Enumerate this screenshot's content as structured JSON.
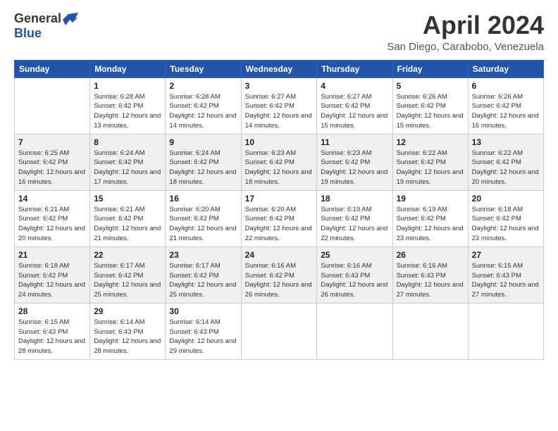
{
  "logo": {
    "general": "General",
    "blue": "Blue"
  },
  "title": "April 2024",
  "subtitle": "San Diego, Carabobo, Venezuela",
  "days_of_week": [
    "Sunday",
    "Monday",
    "Tuesday",
    "Wednesday",
    "Thursday",
    "Friday",
    "Saturday"
  ],
  "weeks": [
    [
      {
        "num": "",
        "sunrise": "",
        "sunset": "",
        "daylight": ""
      },
      {
        "num": "1",
        "sunrise": "Sunrise: 6:28 AM",
        "sunset": "Sunset: 6:42 PM",
        "daylight": "Daylight: 12 hours and 13 minutes."
      },
      {
        "num": "2",
        "sunrise": "Sunrise: 6:28 AM",
        "sunset": "Sunset: 6:42 PM",
        "daylight": "Daylight: 12 hours and 14 minutes."
      },
      {
        "num": "3",
        "sunrise": "Sunrise: 6:27 AM",
        "sunset": "Sunset: 6:42 PM",
        "daylight": "Daylight: 12 hours and 14 minutes."
      },
      {
        "num": "4",
        "sunrise": "Sunrise: 6:27 AM",
        "sunset": "Sunset: 6:42 PM",
        "daylight": "Daylight: 12 hours and 15 minutes."
      },
      {
        "num": "5",
        "sunrise": "Sunrise: 6:26 AM",
        "sunset": "Sunset: 6:42 PM",
        "daylight": "Daylight: 12 hours and 15 minutes."
      },
      {
        "num": "6",
        "sunrise": "Sunrise: 6:26 AM",
        "sunset": "Sunset: 6:42 PM",
        "daylight": "Daylight: 12 hours and 16 minutes."
      }
    ],
    [
      {
        "num": "7",
        "sunrise": "Sunrise: 6:25 AM",
        "sunset": "Sunset: 6:42 PM",
        "daylight": "Daylight: 12 hours and 16 minutes."
      },
      {
        "num": "8",
        "sunrise": "Sunrise: 6:24 AM",
        "sunset": "Sunset: 6:42 PM",
        "daylight": "Daylight: 12 hours and 17 minutes."
      },
      {
        "num": "9",
        "sunrise": "Sunrise: 6:24 AM",
        "sunset": "Sunset: 6:42 PM",
        "daylight": "Daylight: 12 hours and 18 minutes."
      },
      {
        "num": "10",
        "sunrise": "Sunrise: 6:23 AM",
        "sunset": "Sunset: 6:42 PM",
        "daylight": "Daylight: 12 hours and 18 minutes."
      },
      {
        "num": "11",
        "sunrise": "Sunrise: 6:23 AM",
        "sunset": "Sunset: 6:42 PM",
        "daylight": "Daylight: 12 hours and 19 minutes."
      },
      {
        "num": "12",
        "sunrise": "Sunrise: 6:22 AM",
        "sunset": "Sunset: 6:42 PM",
        "daylight": "Daylight: 12 hours and 19 minutes."
      },
      {
        "num": "13",
        "sunrise": "Sunrise: 6:22 AM",
        "sunset": "Sunset: 6:42 PM",
        "daylight": "Daylight: 12 hours and 20 minutes."
      }
    ],
    [
      {
        "num": "14",
        "sunrise": "Sunrise: 6:21 AM",
        "sunset": "Sunset: 6:42 PM",
        "daylight": "Daylight: 12 hours and 20 minutes."
      },
      {
        "num": "15",
        "sunrise": "Sunrise: 6:21 AM",
        "sunset": "Sunset: 6:42 PM",
        "daylight": "Daylight: 12 hours and 21 minutes."
      },
      {
        "num": "16",
        "sunrise": "Sunrise: 6:20 AM",
        "sunset": "Sunset: 6:42 PM",
        "daylight": "Daylight: 12 hours and 21 minutes."
      },
      {
        "num": "17",
        "sunrise": "Sunrise: 6:20 AM",
        "sunset": "Sunset: 6:42 PM",
        "daylight": "Daylight: 12 hours and 22 minutes."
      },
      {
        "num": "18",
        "sunrise": "Sunrise: 6:19 AM",
        "sunset": "Sunset: 6:42 PM",
        "daylight": "Daylight: 12 hours and 22 minutes."
      },
      {
        "num": "19",
        "sunrise": "Sunrise: 6:19 AM",
        "sunset": "Sunset: 6:42 PM",
        "daylight": "Daylight: 12 hours and 23 minutes."
      },
      {
        "num": "20",
        "sunrise": "Sunrise: 6:18 AM",
        "sunset": "Sunset: 6:42 PM",
        "daylight": "Daylight: 12 hours and 23 minutes."
      }
    ],
    [
      {
        "num": "21",
        "sunrise": "Sunrise: 6:18 AM",
        "sunset": "Sunset: 6:42 PM",
        "daylight": "Daylight: 12 hours and 24 minutes."
      },
      {
        "num": "22",
        "sunrise": "Sunrise: 6:17 AM",
        "sunset": "Sunset: 6:42 PM",
        "daylight": "Daylight: 12 hours and 25 minutes."
      },
      {
        "num": "23",
        "sunrise": "Sunrise: 6:17 AM",
        "sunset": "Sunset: 6:42 PM",
        "daylight": "Daylight: 12 hours and 25 minutes."
      },
      {
        "num": "24",
        "sunrise": "Sunrise: 6:16 AM",
        "sunset": "Sunset: 6:42 PM",
        "daylight": "Daylight: 12 hours and 26 minutes."
      },
      {
        "num": "25",
        "sunrise": "Sunrise: 6:16 AM",
        "sunset": "Sunset: 6:43 PM",
        "daylight": "Daylight: 12 hours and 26 minutes."
      },
      {
        "num": "26",
        "sunrise": "Sunrise: 6:16 AM",
        "sunset": "Sunset: 6:43 PM",
        "daylight": "Daylight: 12 hours and 27 minutes."
      },
      {
        "num": "27",
        "sunrise": "Sunrise: 6:15 AM",
        "sunset": "Sunset: 6:43 PM",
        "daylight": "Daylight: 12 hours and 27 minutes."
      }
    ],
    [
      {
        "num": "28",
        "sunrise": "Sunrise: 6:15 AM",
        "sunset": "Sunset: 6:43 PM",
        "daylight": "Daylight: 12 hours and 28 minutes."
      },
      {
        "num": "29",
        "sunrise": "Sunrise: 6:14 AM",
        "sunset": "Sunset: 6:43 PM",
        "daylight": "Daylight: 12 hours and 28 minutes."
      },
      {
        "num": "30",
        "sunrise": "Sunrise: 6:14 AM",
        "sunset": "Sunset: 6:43 PM",
        "daylight": "Daylight: 12 hours and 29 minutes."
      },
      {
        "num": "",
        "sunrise": "",
        "sunset": "",
        "daylight": ""
      },
      {
        "num": "",
        "sunrise": "",
        "sunset": "",
        "daylight": ""
      },
      {
        "num": "",
        "sunrise": "",
        "sunset": "",
        "daylight": ""
      },
      {
        "num": "",
        "sunrise": "",
        "sunset": "",
        "daylight": ""
      }
    ]
  ]
}
